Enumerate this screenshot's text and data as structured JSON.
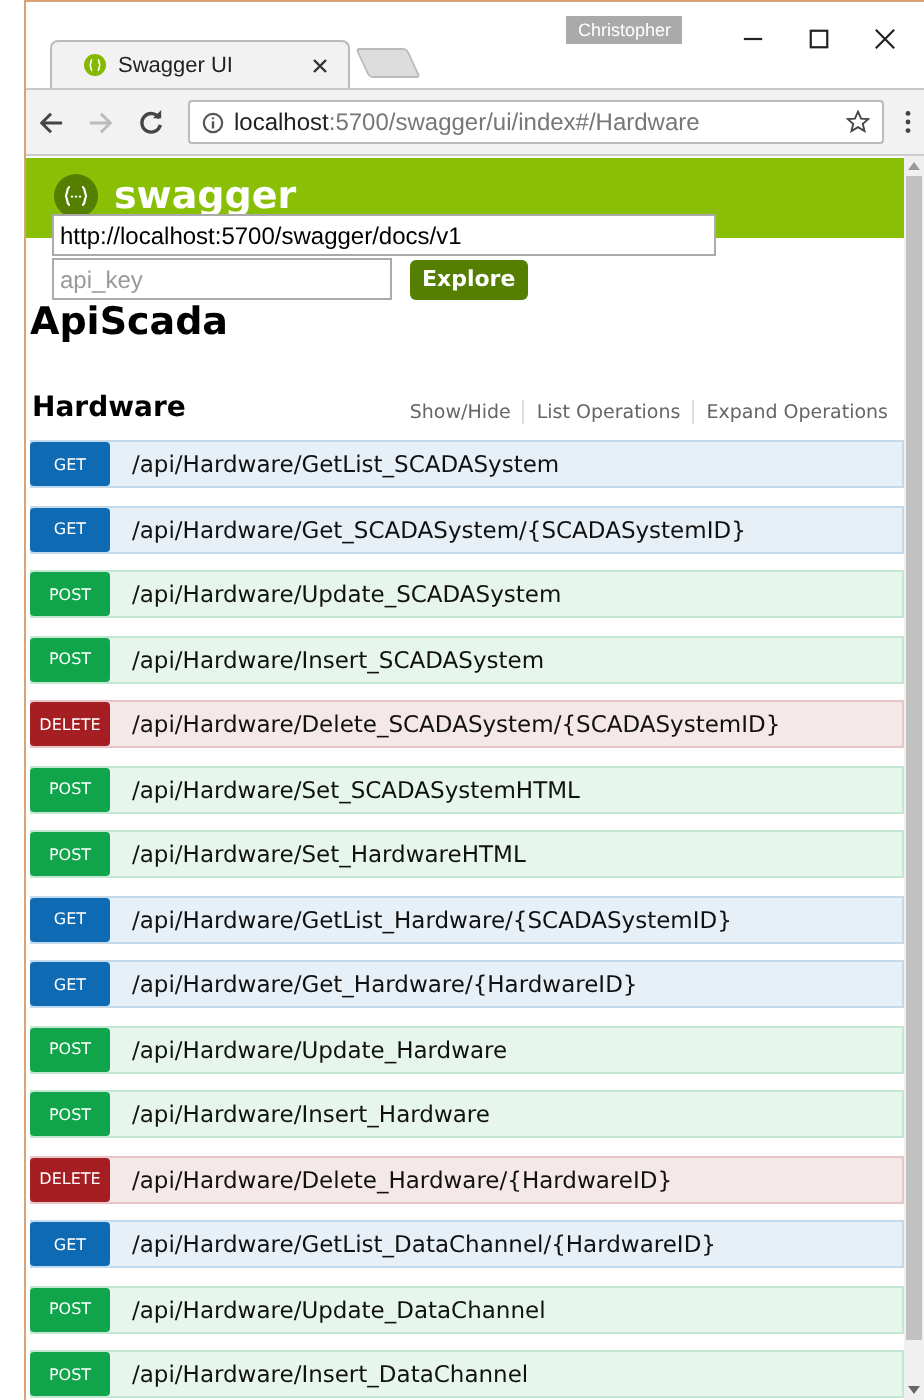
{
  "window": {
    "user": "Christopher"
  },
  "tabs": [
    {
      "title": "Swagger UI",
      "selected": true
    }
  ],
  "address_bar": {
    "host": "localhost",
    "path": ":5700/swagger/ui/index#/Hardware"
  },
  "header": {
    "brand": "swagger",
    "url_field": {
      "value": "http://localhost:5700/swagger/docs/v1"
    },
    "api_key_field": {
      "placeholder": "api_key"
    },
    "explore_button": "Explore"
  },
  "api_title": "ApiScada",
  "section": {
    "title": "Hardware",
    "links": [
      "Show/Hide",
      "List Operations",
      "Expand Operations"
    ]
  },
  "operations": [
    {
      "kind": "get",
      "method": "GET",
      "path": "/api/Hardware/GetList_SCADASystem"
    },
    {
      "kind": "get",
      "method": "GET",
      "path": "/api/Hardware/Get_SCADASystem/{SCADASystemID}"
    },
    {
      "kind": "post",
      "method": "POST",
      "path": "/api/Hardware/Update_SCADASystem"
    },
    {
      "kind": "post",
      "method": "POST",
      "path": "/api/Hardware/Insert_SCADASystem"
    },
    {
      "kind": "delete",
      "method": "DELETE",
      "path": "/api/Hardware/Delete_SCADASystem/{SCADASystemID}"
    },
    {
      "kind": "post",
      "method": "POST",
      "path": "/api/Hardware/Set_SCADASystemHTML"
    },
    {
      "kind": "post",
      "method": "POST",
      "path": "/api/Hardware/Set_HardwareHTML"
    },
    {
      "kind": "get",
      "method": "GET",
      "path": "/api/Hardware/GetList_Hardware/{SCADASystemID}"
    },
    {
      "kind": "get",
      "method": "GET",
      "path": "/api/Hardware/Get_Hardware/{HardwareID}"
    },
    {
      "kind": "post",
      "method": "POST",
      "path": "/api/Hardware/Update_Hardware"
    },
    {
      "kind": "post",
      "method": "POST",
      "path": "/api/Hardware/Insert_Hardware"
    },
    {
      "kind": "delete",
      "method": "DELETE",
      "path": "/api/Hardware/Delete_Hardware/{HardwareID}"
    },
    {
      "kind": "get",
      "method": "GET",
      "path": "/api/Hardware/GetList_DataChannel/{HardwareID}"
    },
    {
      "kind": "post",
      "method": "POST",
      "path": "/api/Hardware/Update_DataChannel"
    },
    {
      "kind": "post",
      "method": "POST",
      "path": "/api/Hardware/Insert_DataChannel"
    }
  ]
}
